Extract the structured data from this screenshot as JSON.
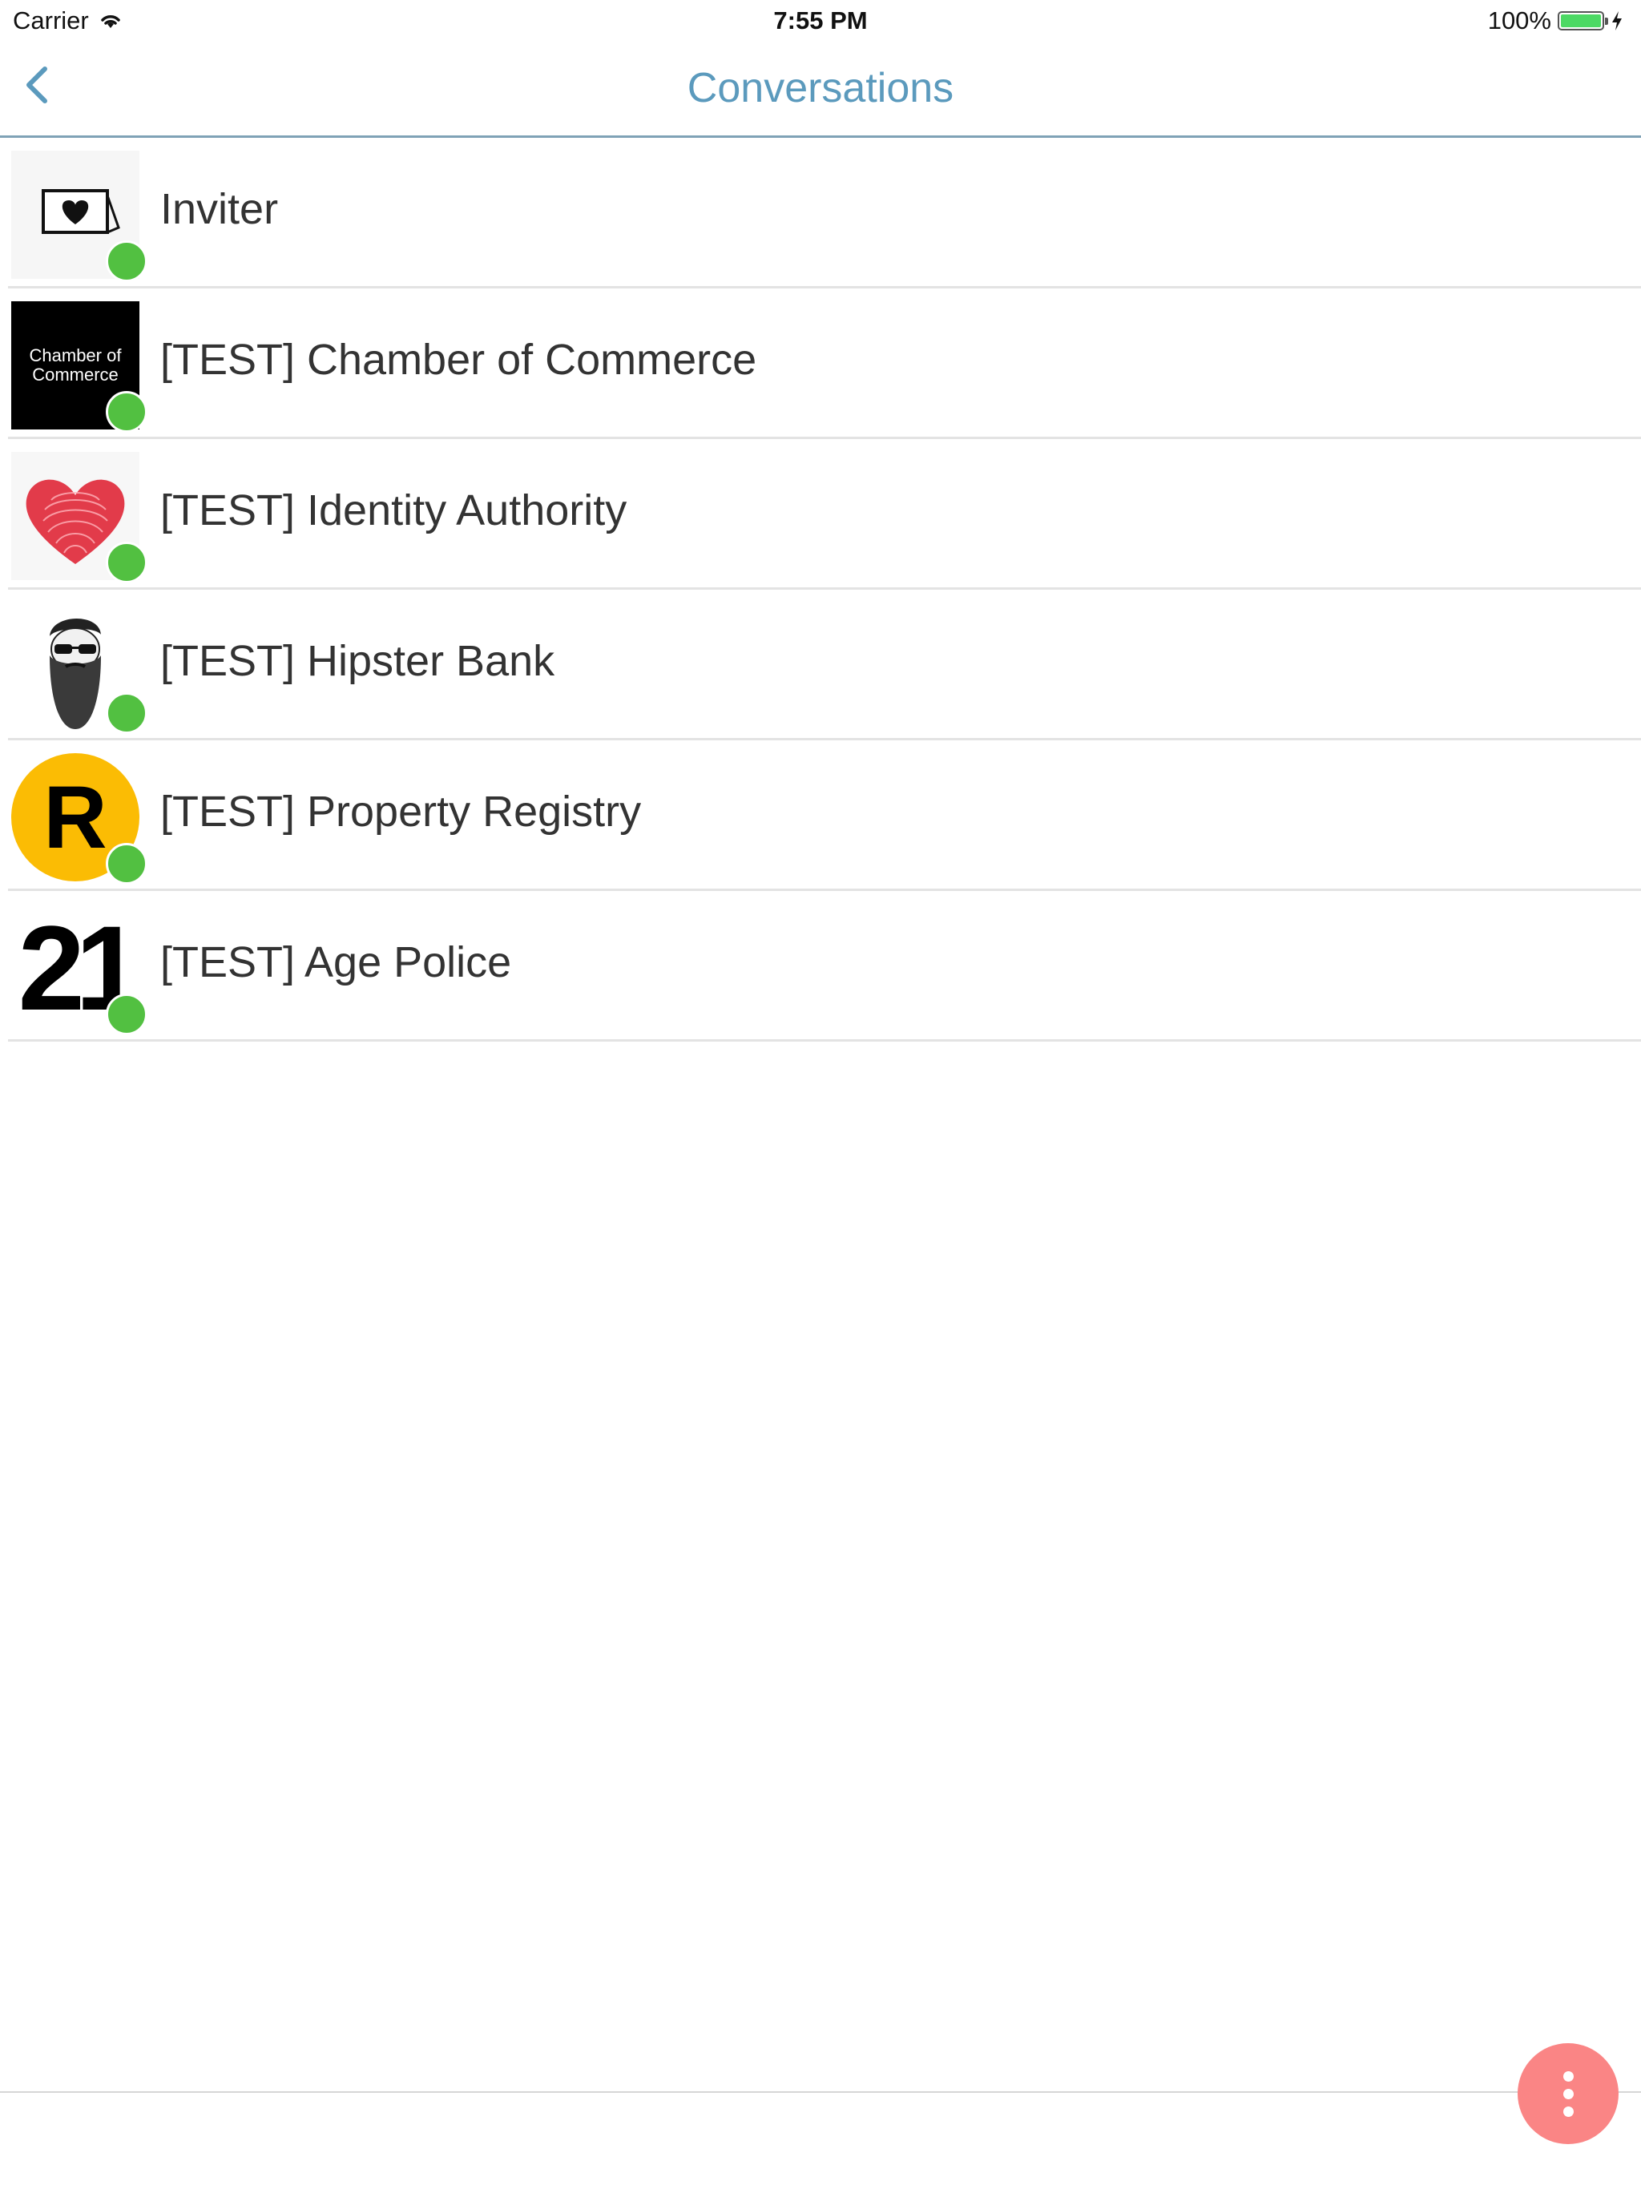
{
  "status_bar": {
    "carrier": "Carrier",
    "time": "7:55 PM",
    "battery_percent": "100%",
    "battery_level": 1.0,
    "wifi_icon": "wifi-icon",
    "charging_icon": "lightning-icon"
  },
  "nav": {
    "title": "Conversations",
    "back_icon": "chevron-left-icon"
  },
  "conversations": [
    {
      "name": "Inviter",
      "avatar": "envelope-heart-icon",
      "online": true
    },
    {
      "name": "[TEST] Chamber of Commerce",
      "avatar_text": "Chamber of Commerce",
      "online": true
    },
    {
      "name": "[TEST] Identity Authority",
      "avatar": "fingerprint-heart-icon",
      "online": true
    },
    {
      "name": "[TEST] Hipster Bank",
      "avatar": "bearded-hipster-icon",
      "online": true
    },
    {
      "name": "[TEST] Property Registry",
      "avatar_text": "R",
      "online": true
    },
    {
      "name": "[TEST] Age Police",
      "avatar_text": "21",
      "online": true
    }
  ],
  "fab": {
    "icon": "more-vertical-icon"
  },
  "colors": {
    "title": "#5b9abd",
    "online": "#52c041",
    "fab": "#fa8585",
    "registry_yellow": "#fbbc04"
  }
}
